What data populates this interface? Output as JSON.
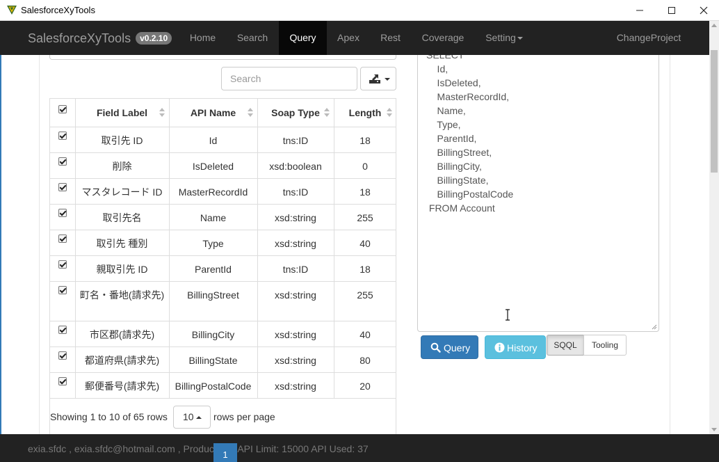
{
  "window": {
    "title": "SalesforceXyTools",
    "minimize": "—",
    "maximize": "☐",
    "close": "✕"
  },
  "navbar": {
    "brand": "SalesforceXyTools",
    "version": "v0.2.10",
    "items": [
      {
        "label": "Home"
      },
      {
        "label": "Search"
      },
      {
        "label": "Query",
        "active": true
      },
      {
        "label": "Apex"
      },
      {
        "label": "Rest"
      },
      {
        "label": "Coverage"
      },
      {
        "label": "Setting"
      },
      {
        "label": "ChangeProject"
      }
    ]
  },
  "search": {
    "placeholder": "Search"
  },
  "table": {
    "columns": [
      "Field Label",
      "API Name",
      "Soap Type",
      "Length"
    ],
    "rows": [
      {
        "label": "取引先 ID",
        "api": "Id",
        "soap": "tns:ID",
        "length": "18"
      },
      {
        "label": "削除",
        "api": "IsDeleted",
        "soap": "xsd:boolean",
        "length": "0"
      },
      {
        "label": "マスタレコード ID",
        "api": "MasterRecordId",
        "soap": "tns:ID",
        "length": "18"
      },
      {
        "label": "取引先名",
        "api": "Name",
        "soap": "xsd:string",
        "length": "255"
      },
      {
        "label": "取引先 種別",
        "api": "Type",
        "soap": "xsd:string",
        "length": "40"
      },
      {
        "label": "親取引先 ID",
        "api": "ParentId",
        "soap": "tns:ID",
        "length": "18"
      },
      {
        "label": "町名・番地(請求先)",
        "api": "BillingStreet",
        "soap": "xsd:string",
        "length": "255"
      },
      {
        "label": "市区郡(請求先)",
        "api": "BillingCity",
        "soap": "xsd:string",
        "length": "40"
      },
      {
        "label": "都道府県(請求先)",
        "api": "BillingState",
        "soap": "xsd:string",
        "length": "80"
      },
      {
        "label": "郵便番号(請求先)",
        "api": "BillingPostalCode",
        "soap": "xsd:string",
        "length": "20"
      }
    ]
  },
  "pagination": {
    "showing": "Showing 1 to 10 of 65 rows",
    "page_size": "10",
    "rows_per_page": "rows per page",
    "current_page": "1"
  },
  "query": {
    "text": "SELECT\n    Id,\n    IsDeleted,\n    MasterRecordId,\n    Name,\n    Type,\n    ParentId,\n    BillingStreet,\n    BillingCity,\n    BillingState,\n    BillingPostalCode\n FROM Account",
    "query_button": "Query",
    "history_button": "History",
    "sqql_button": "SQQL",
    "tooling_button": "Tooling"
  },
  "footer": {
    "text": "exia.sfdc , exia.sfdc@hotmail.com , Production , API Limit: 15000 API Used: 37"
  },
  "colors": {
    "navbar_bg": "#222222",
    "primary": "#337ab7",
    "info": "#5bc0de"
  }
}
